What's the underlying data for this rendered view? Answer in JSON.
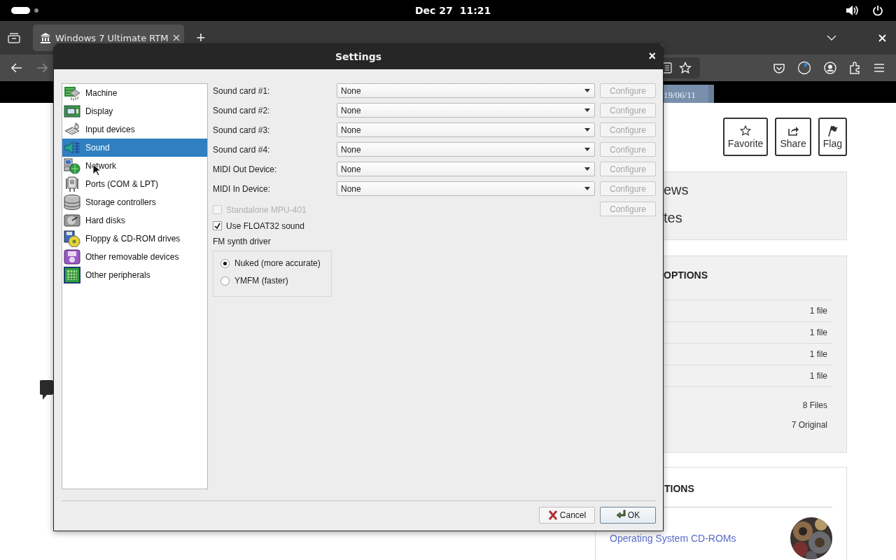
{
  "top_bar": {
    "date": "Dec 27",
    "time": "11:21"
  },
  "browser": {
    "tabs": [
      {
        "title": "Windows 7 Ultimate RTM",
        "selected": true
      }
    ],
    "new_tab": "+"
  },
  "page": {
    "strip_text": "19/06/11",
    "actions": [
      {
        "label": "Favorite",
        "kind": "star"
      },
      {
        "label": "Share",
        "kind": "share"
      },
      {
        "label": "Flag",
        "kind": "flag"
      }
    ],
    "stats": [
      "ews",
      "tes"
    ],
    "download_options": {
      "heading": "OPTIONS",
      "rows": [
        "1 file",
        "1 file",
        "1 file",
        "1 file"
      ],
      "totals": [
        "8 Files",
        "7 Original"
      ]
    },
    "collections": {
      "heading": "TIONS",
      "link": "Operating System CD-ROMs"
    }
  },
  "dialog": {
    "title": "Settings",
    "close": "×",
    "categories": [
      {
        "label": "Machine",
        "selected": false
      },
      {
        "label": "Display",
        "selected": false
      },
      {
        "label": "Input devices",
        "selected": false
      },
      {
        "label": "Sound",
        "selected": true
      },
      {
        "label": "Network",
        "selected": false
      },
      {
        "label": "Ports (COM & LPT)",
        "selected": false
      },
      {
        "label": "Storage controllers",
        "selected": false
      },
      {
        "label": "Hard disks",
        "selected": false
      },
      {
        "label": "Floppy & CD-ROM drives",
        "selected": false
      },
      {
        "label": "Other removable devices",
        "selected": false
      },
      {
        "label": "Other peripherals",
        "selected": false
      }
    ],
    "devices": [
      {
        "label": "Sound card #1:",
        "value": "None",
        "configure": "Configure",
        "disabled": true
      },
      {
        "label": "Sound card #2:",
        "value": "None",
        "configure": "Configure",
        "disabled": true
      },
      {
        "label": "Sound card #3:",
        "value": "None",
        "configure": "Configure",
        "disabled": true
      },
      {
        "label": "Sound card #4:",
        "value": "None",
        "configure": "Configure",
        "disabled": true
      },
      {
        "label": "MIDI Out Device:",
        "value": "None",
        "configure": "Configure",
        "disabled": true
      },
      {
        "label": "MIDI In Device:",
        "value": "None",
        "configure": "Configure",
        "disabled": true
      }
    ],
    "mpu": {
      "label": "Standalone MPU-401",
      "checked": false,
      "disabled": true,
      "configure": "Configure",
      "configure_disabled": true
    },
    "float32": {
      "label": "Use FLOAT32 sound",
      "checked": true,
      "disabled": false
    },
    "fm_synth": {
      "label": "FM synth driver",
      "options": [
        {
          "label": "Nuked (more accurate)",
          "selected": true
        },
        {
          "label": "YMFM (faster)",
          "selected": false
        }
      ]
    },
    "buttons": [
      {
        "label": "Cancel",
        "kind": "cancel",
        "default": false
      },
      {
        "label": "OK",
        "kind": "ok",
        "default": true
      }
    ]
  }
}
